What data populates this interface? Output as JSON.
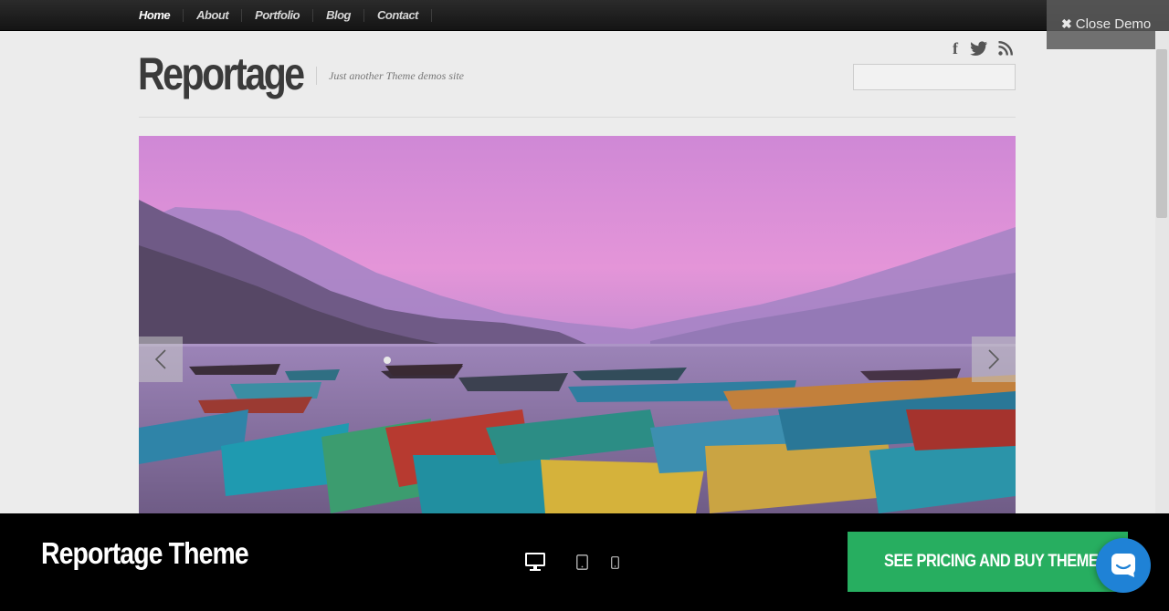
{
  "nav": {
    "items": [
      {
        "label": "Home"
      },
      {
        "label": "About"
      },
      {
        "label": "Portfolio"
      },
      {
        "label": "Blog"
      },
      {
        "label": "Contact"
      }
    ]
  },
  "close_demo": {
    "icon": "close-icon",
    "label": "Close Demo"
  },
  "site": {
    "title": "Reportage",
    "tagline": "Just another Theme demos site"
  },
  "social": [
    {
      "icon": "facebook-icon",
      "glyph": "f"
    },
    {
      "icon": "twitter-icon"
    },
    {
      "icon": "rss-icon"
    }
  ],
  "search": {
    "value": "",
    "placeholder": ""
  },
  "slider": {
    "prev_icon": "chevron-left-icon",
    "next_icon": "chevron-right-icon"
  },
  "demo_bar": {
    "theme_name": "Reportage Theme",
    "devices": [
      "desktop-icon",
      "tablet-icon",
      "phone-icon"
    ],
    "buy_label": "SEE PRICING AND BUY THEME",
    "chat_icon": "chat-icon"
  },
  "colors": {
    "accent_green": "#27ae60",
    "chat_blue": "#1f82d6",
    "nav_bg": "#1a1a1a"
  }
}
